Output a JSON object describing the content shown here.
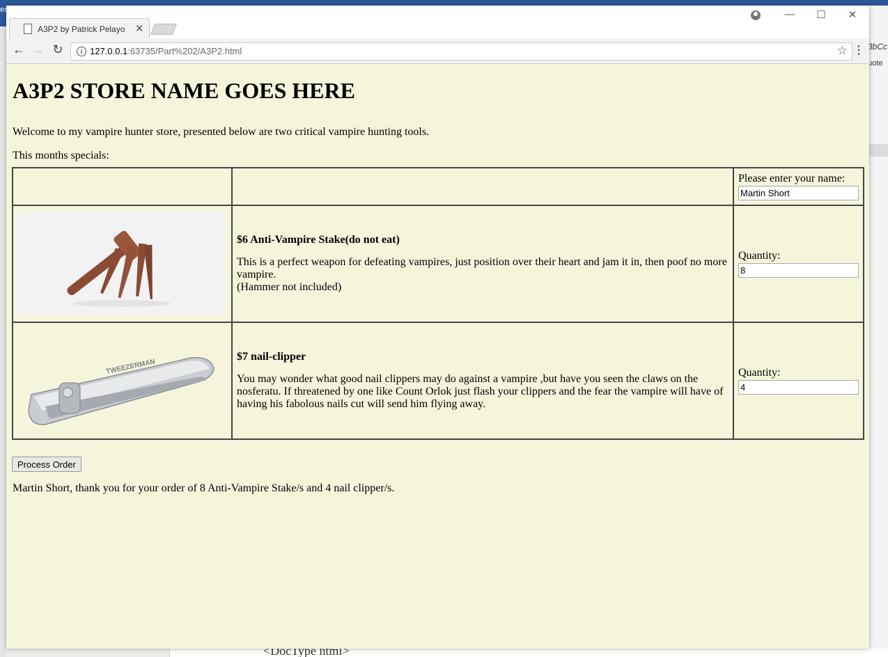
{
  "background": {
    "left_text": "er",
    "right_text_1": "3bCc",
    "right_text_2": "uote",
    "bottom_doc_text": "<DocType html>"
  },
  "browser": {
    "tab_title": "A3P2 by Patrick Pelayo",
    "url_host": "127.0.0.1",
    "url_path": ":63735/Part%202/A3P2.html"
  },
  "page": {
    "heading": "A3P2 STORE NAME GOES HERE",
    "welcome": "Welcome to my vampire hunter store, presented below are two critical vampire hunting tools.",
    "specials": "This months specials:",
    "name_label": "Please enter your name:",
    "name_value": "Martin Short",
    "products": [
      {
        "title": "$6 Anti-Vampire Stake(do not eat)",
        "desc_line1": "This is a perfect weapon for defeating vampires, just position over their heart and jam it in, then poof no more vampire.",
        "desc_line2": "(Hammer not included)",
        "qty_label": "Quantity:",
        "qty_value": "8"
      },
      {
        "title": "$7 nail-clipper",
        "desc_line1": "You may wonder what good nail clippers may do against a vampire ,but have you seen the claws on the nosferatu. If threatened by one like Count Orlok just flash your clippers and the fear the vampire will have of having his fabolous nails cut will send him flying away.",
        "brand_text": "TWEEZERMAN",
        "qty_label": "Quantity:",
        "qty_value": "4"
      }
    ],
    "process_button": "Process Order",
    "thank_you": "Martin Short, thank you for your order of 8 Anti-Vampire Stake/s and 4 nail clipper/s."
  }
}
